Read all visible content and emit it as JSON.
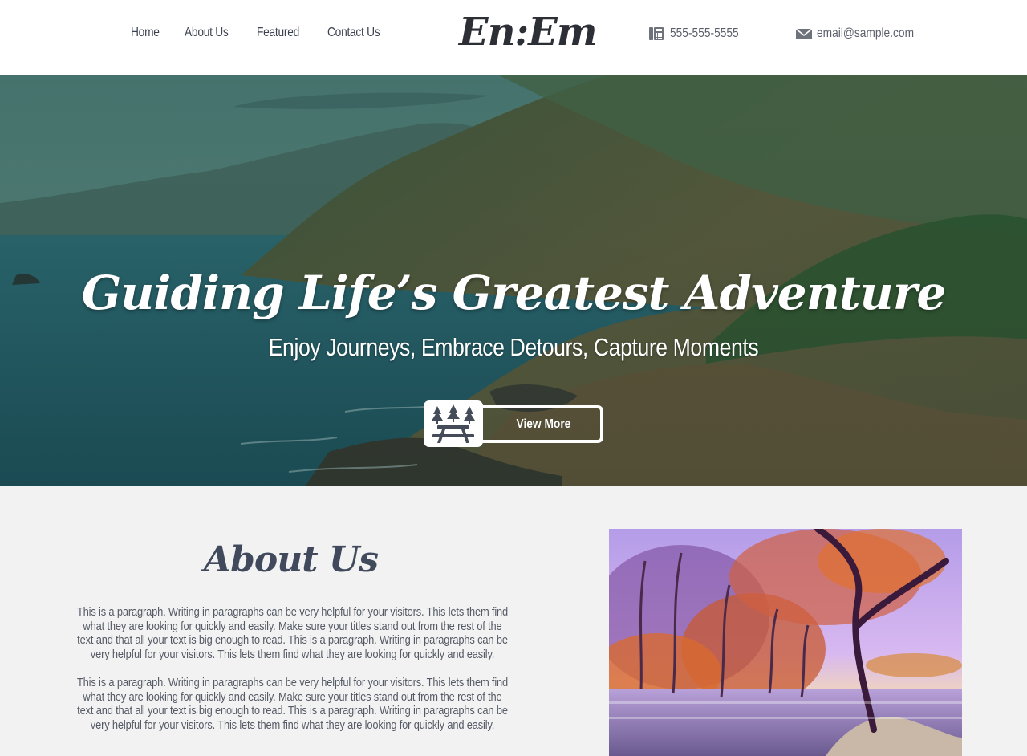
{
  "nav": {
    "items": [
      "Home",
      "About Us",
      "Featured",
      "Contact Us"
    ]
  },
  "logo": {
    "text": "En:Em"
  },
  "contact": {
    "phone": "555-555-5555",
    "phone_icon": "phone-icon",
    "email": "email@sample.com",
    "email_icon": "envelope-icon"
  },
  "hero": {
    "title": "Guiding Life’s Greatest Adventure",
    "subtitle": "Enjoy Journeys, Embrace Detours, Capture Moments",
    "button_label": "View More",
    "button_icon": "picnic-table-icon"
  },
  "about": {
    "title": "About Us",
    "paragraphs": [
      "This is a paragraph. Writing in paragraphs can be very helpful for your visitors. This lets them find what they are looking for quickly and easily. Make sure your titles stand out from the rest of the text and that all your text is big enough to read. This is a paragraph. Writing in paragraphs can be very helpful for your visitors. This lets them find what they are looking for quickly and easily.",
      "This is a paragraph. Writing in paragraphs can be very helpful for your visitors. This lets them find what they are looking for quickly and easily. Make sure your titles stand out from the rest of the text and that all your text is big enough to read. This is a paragraph. Writing in paragraphs can be very helpful for your visitors. This lets them find what they are looking for quickly and easily."
    ]
  },
  "colors": {
    "header_bg": "#ffffff",
    "page_bg": "#f2f2f2",
    "text_dark": "#404a5c",
    "hero_text": "#ffffff"
  }
}
